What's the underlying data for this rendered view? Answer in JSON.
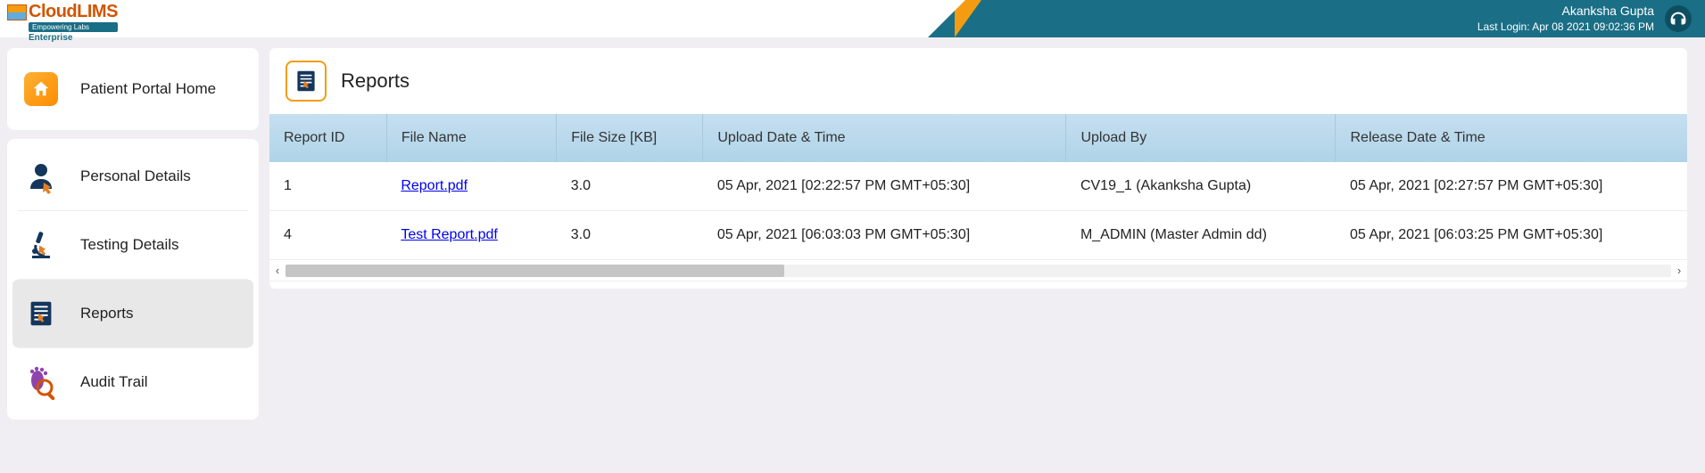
{
  "header": {
    "logo_main": "CloudLIMS",
    "logo_sub": "Empowering Labs",
    "logo_edition": "Enterprise",
    "user_name": "Akanksha Gupta",
    "last_login": "Last Login: Apr 08 2021 09:02:36 PM"
  },
  "sidebar": {
    "home_label": "Patient Portal Home",
    "items": [
      {
        "label": "Personal Details",
        "icon": "person"
      },
      {
        "label": "Testing Details",
        "icon": "microscope"
      },
      {
        "label": "Reports",
        "icon": "reports",
        "active": true
      },
      {
        "label": "Audit Trail",
        "icon": "footprint"
      }
    ]
  },
  "page": {
    "title": "Reports"
  },
  "table": {
    "columns": [
      "Report ID",
      "File Name",
      "File Size [KB]",
      "Upload Date & Time",
      "Upload By",
      "Release Date & Time"
    ],
    "rows": [
      {
        "id": "1",
        "file": "Report.pdf",
        "size": "3.0",
        "upload_dt": "05 Apr, 2021 [02:22:57 PM GMT+05:30]",
        "upload_by": "CV19_1 (Akanksha Gupta)",
        "release_dt": "05 Apr, 2021 [02:27:57 PM GMT+05:30]"
      },
      {
        "id": "4",
        "file": "Test Report.pdf",
        "size": "3.0",
        "upload_dt": "05 Apr, 2021 [06:03:03 PM GMT+05:30]",
        "upload_by": "M_ADMIN (Master Admin dd)",
        "release_dt": "05 Apr, 2021 [06:03:25 PM GMT+05:30]"
      }
    ]
  }
}
